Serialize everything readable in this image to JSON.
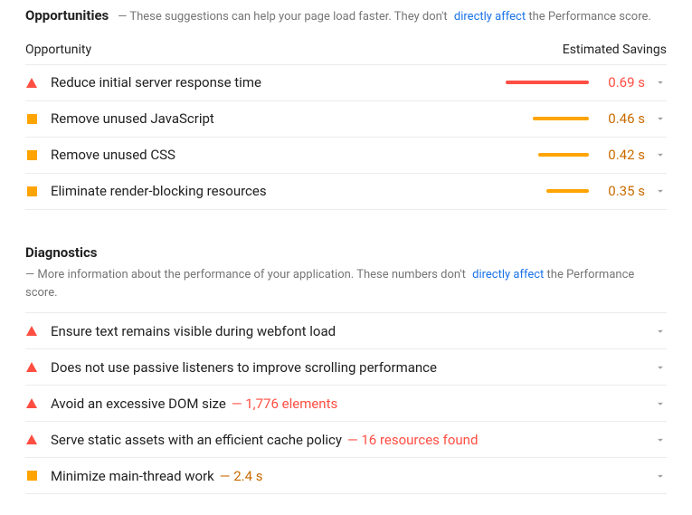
{
  "opportunities": {
    "title": "Opportunities",
    "desc_prefix": "— These suggestions can help your page load faster. They don't ",
    "desc_link": "directly affect",
    "desc_suffix": " the Performance score.",
    "col_opportunity": "Opportunity",
    "col_savings": "Estimated Savings",
    "items": [
      {
        "severity": "fail",
        "title": "Reduce initial server response time",
        "savings": "0.69 s",
        "bar": 92
      },
      {
        "severity": "avg",
        "title": "Remove unused JavaScript",
        "savings": "0.46 s",
        "bar": 62
      },
      {
        "severity": "avg",
        "title": "Remove unused CSS",
        "savings": "0.42 s",
        "bar": 56
      },
      {
        "severity": "avg",
        "title": "Eliminate render-blocking resources",
        "savings": "0.35 s",
        "bar": 47
      }
    ]
  },
  "diagnostics": {
    "title": "Diagnostics",
    "desc_prefix": "— More information about the performance of your application. These numbers don't ",
    "desc_link": "directly affect",
    "desc_suffix": " the Performance score.",
    "items": [
      {
        "severity": "fail",
        "title": "Ensure text remains visible during webfont load",
        "detail": ""
      },
      {
        "severity": "fail",
        "title": "Does not use passive listeners to improve scrolling performance",
        "detail": ""
      },
      {
        "severity": "fail",
        "title": "Avoid an excessive DOM size",
        "detail": "— 1,776 elements"
      },
      {
        "severity": "fail",
        "title": "Serve static assets with an efficient cache policy",
        "detail": "— 16 resources found"
      },
      {
        "severity": "avg",
        "title": "Minimize main-thread work",
        "detail": "— 2.4 s"
      }
    ]
  }
}
